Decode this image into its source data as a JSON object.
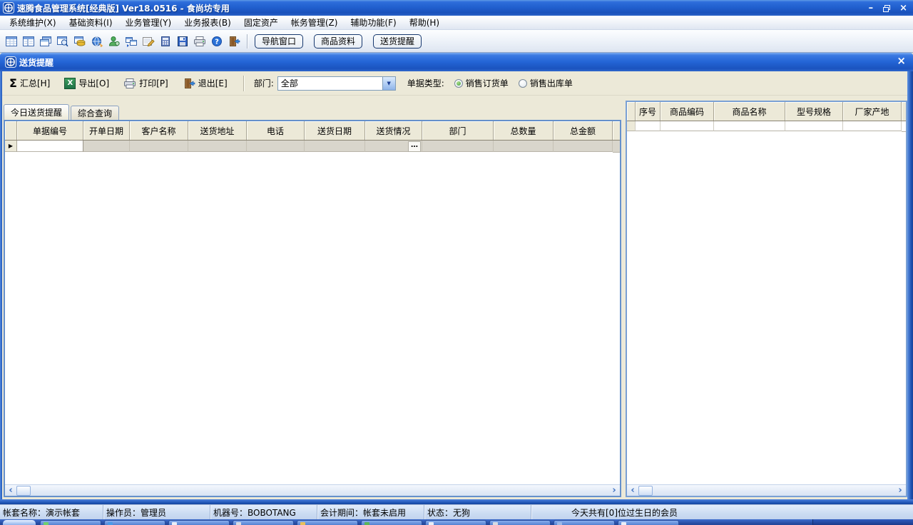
{
  "app": {
    "title": "速腾食品管理系统[经典版] Ver18.0516  -  食尚坊专用"
  },
  "glyphs": {
    "minimize": "–",
    "close": "×",
    "combo_arrow": "▼",
    "scroll_left": "‹",
    "scroll_right": "›",
    "row_marker": "▶",
    "sigma": "Σ",
    "excel_x": "X",
    "ellipsis": "…"
  },
  "menu": {
    "items": [
      "系统维护(X)",
      "基础资料(I)",
      "业务管理(Y)",
      "业务报表(B)",
      "固定资产",
      "帐务管理(Z)",
      "辅助功能(F)",
      "帮助(H)"
    ]
  },
  "toolbar": {
    "icons": [
      "grid-window",
      "form-window",
      "cascade-windows",
      "search-window",
      "money",
      "globe",
      "user",
      "window-switch",
      "edit-form",
      "calculator",
      "save",
      "print",
      "help",
      "exit"
    ],
    "buttons": [
      "导航窗口",
      "商品资料",
      "送货提醒"
    ]
  },
  "child_window": {
    "title": "送货提醒",
    "toolbar": {
      "summarize": "汇总[H]",
      "export": "导出[O]",
      "print": "打印[P]",
      "exit": "退出[E]",
      "department_label": "部门:",
      "department_value": "全部",
      "doc_type_label": "单据类型:",
      "doc_type_options": [
        "销售订货单",
        "销售出库单"
      ],
      "doc_type_selected": "销售订货单"
    },
    "tabs": [
      "今日送货提醒",
      "综合查询"
    ],
    "active_tab": "今日送货提醒",
    "left_grid": {
      "columns": [
        "单据编号",
        "开单日期",
        "客户名称",
        "送货地址",
        "电话",
        "送货日期",
        "送货情况",
        "部门",
        "总数量",
        "总金额"
      ],
      "rows": [
        {
          "单据编号": "",
          "开单日期": "",
          "客户名称": "",
          "送货地址": "",
          "电话": "",
          "送货日期": "",
          "送货情况": "",
          "部门": "",
          "总数量": "",
          "总金额": ""
        }
      ]
    },
    "right_grid": {
      "columns": [
        "序号",
        "商品编码",
        "商品名称",
        "型号规格",
        "厂家产地"
      ],
      "rows": []
    }
  },
  "status_bar": {
    "items": [
      "帐套名称：演示帐套",
      "操作员：管理员",
      "机器号：BOBOTANG",
      "会计期间：帐套未启用",
      "状态：无狗",
      "今天共有[0]位过生日的会员"
    ]
  }
}
